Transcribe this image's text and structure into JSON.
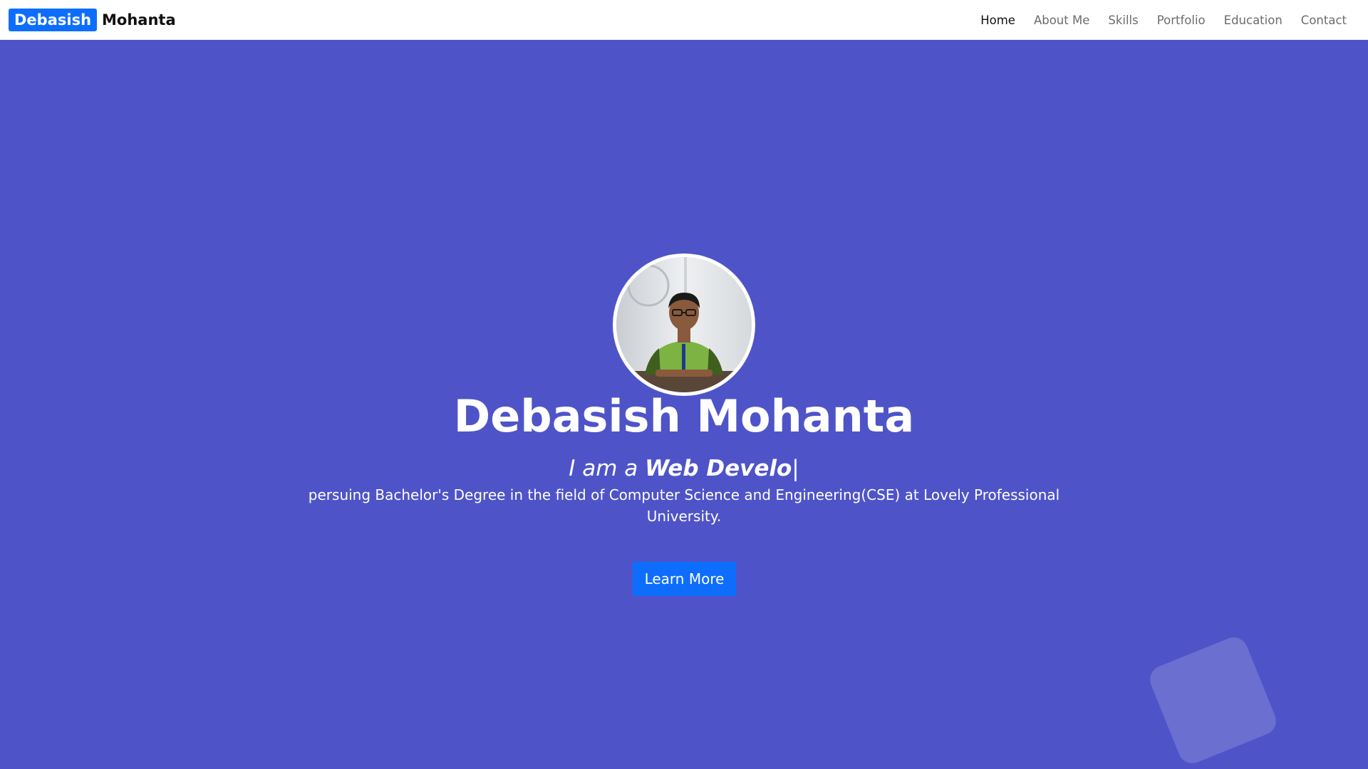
{
  "brand": {
    "first": "Debasish",
    "last": "Mohanta"
  },
  "nav": {
    "items": [
      {
        "label": "Home",
        "active": true
      },
      {
        "label": "About Me",
        "active": false
      },
      {
        "label": "Skills",
        "active": false
      },
      {
        "label": "Portfolio",
        "active": false
      },
      {
        "label": "Education",
        "active": false
      },
      {
        "label": "Contact",
        "active": false
      }
    ]
  },
  "hero": {
    "name": "Debasish Mohanta",
    "typed_prefix": "I am a",
    "typed_text": "Web Develo",
    "cursor": "|",
    "description": "persuing Bachelor's Degree in the field of Computer Science and Engineering(CSE) at Lovely Professional University.",
    "button_label": "Learn More",
    "avatar_icon": "profile-photo"
  },
  "colors": {
    "hero_bg": "#4e54c8",
    "brand_highlight": "#0d6efd",
    "button": "#0d6efd",
    "nav_bg": "#ffffff"
  }
}
